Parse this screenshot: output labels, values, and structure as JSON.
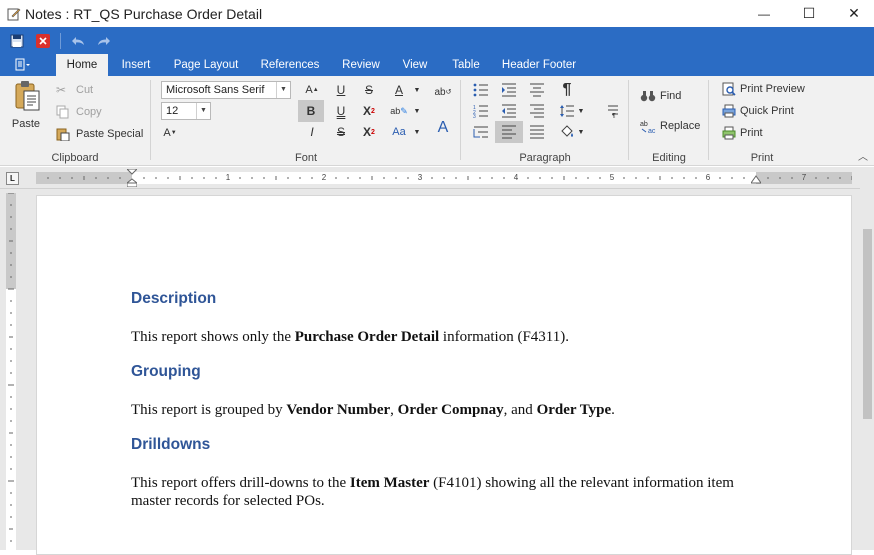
{
  "window": {
    "title": "Notes : RT_QS Purchase Order Detail",
    "minimize_glyph": "—",
    "maximize_glyph": "☐",
    "close_glyph": "✕"
  },
  "ribbon_tabs": [
    "Home",
    "Insert",
    "Page Layout",
    "References",
    "Review",
    "View",
    "Table",
    "Header Footer"
  ],
  "clipboard": {
    "label": "Clipboard",
    "paste": "Paste",
    "cut": "Cut",
    "copy": "Copy",
    "paste_special": "Paste Special"
  },
  "font": {
    "label": "Font",
    "family": "Microsoft Sans Serif",
    "size": "12"
  },
  "paragraph": {
    "label": "Paragraph"
  },
  "editing": {
    "label": "Editing",
    "find": "Find",
    "replace": "Replace"
  },
  "print": {
    "label": "Print",
    "print_preview": "Print Preview",
    "quick_print": "Quick Print",
    "print": "Print"
  },
  "ruler": {
    "numbers": [
      "1",
      "2",
      "3",
      "4",
      "5",
      "6",
      "7"
    ]
  },
  "document": {
    "sections": [
      {
        "heading": "Description",
        "text": [
          "This report shows only the ",
          "Purchase Order Detail",
          " information (F4311)."
        ]
      },
      {
        "heading": "Grouping",
        "text": [
          "This report is grouped by ",
          "Vendor Number",
          ", ",
          "Order Compnay",
          ", and ",
          "Order Type",
          "."
        ]
      },
      {
        "heading": "Drilldowns",
        "text": [
          "This report offers drill-downs to the ",
          "Item Master",
          " (F4101) showing all the relevant information item master records for selected POs."
        ]
      }
    ]
  }
}
